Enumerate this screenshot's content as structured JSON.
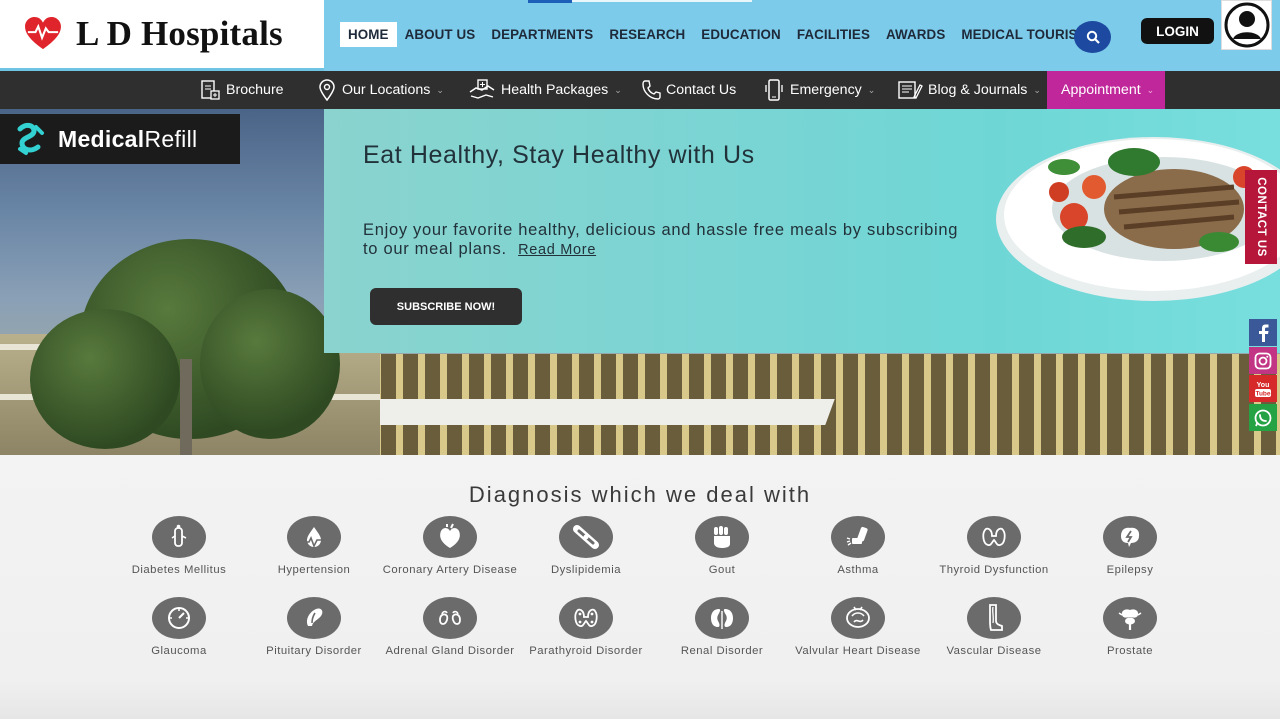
{
  "brand": {
    "name": "L D Hospitals",
    "heart_color": "#e0242b"
  },
  "nav": {
    "items": [
      "HOME",
      "ABOUT US",
      "DEPARTMENTS",
      "RESEARCH",
      "EDUCATION",
      "FACILITIES",
      "AWARDS",
      "MEDICAL TOURISM"
    ],
    "active": "HOME",
    "login_label": "LOGIN",
    "bar_color": "#7ccbea"
  },
  "subnav": {
    "brochure": "Brochure",
    "locations": "Our Locations",
    "packages": "Health Packages",
    "contact": "Contact Us",
    "emergency": "Emergency",
    "blog": "Blog & Journals",
    "appointment": "Appointment",
    "appointment_color": "#c0279a"
  },
  "hero": {
    "badge_bold": "Medical",
    "badge_light": "Refill",
    "title": "Eat Healthy, Stay Healthy with Us",
    "text": "Enjoy your favorite healthy, delicious and hassle free meals by subscribing to our meal plans.",
    "read_more": "Read More",
    "subscribe": "SUBSCRIBE NOW!",
    "contact_tab": "CONTACT US"
  },
  "social": [
    {
      "icon": "facebook-icon",
      "color": "#3b5998"
    },
    {
      "icon": "instagram-icon",
      "color": "#c13584"
    },
    {
      "icon": "youtube-icon",
      "color": "#d62a2a"
    },
    {
      "icon": "whatsapp-icon",
      "color": "#25a244"
    }
  ],
  "diagnosis": {
    "title": "Diagnosis which we deal with",
    "row1": [
      "Diabetes Mellitus",
      "Hypertension",
      "Coronary Artery Disease",
      "Dyslipidemia",
      "Gout",
      "Asthma",
      "Thyroid Dysfunction",
      "Epilepsy"
    ],
    "row2": [
      "Glaucoma",
      "Pituitary Disorder",
      "Adrenal Gland Disorder",
      "Parathyroid Disorder",
      "Renal Disorder",
      "Valvular Heart Disease",
      "Vascular Disease",
      "Prostate"
    ]
  }
}
